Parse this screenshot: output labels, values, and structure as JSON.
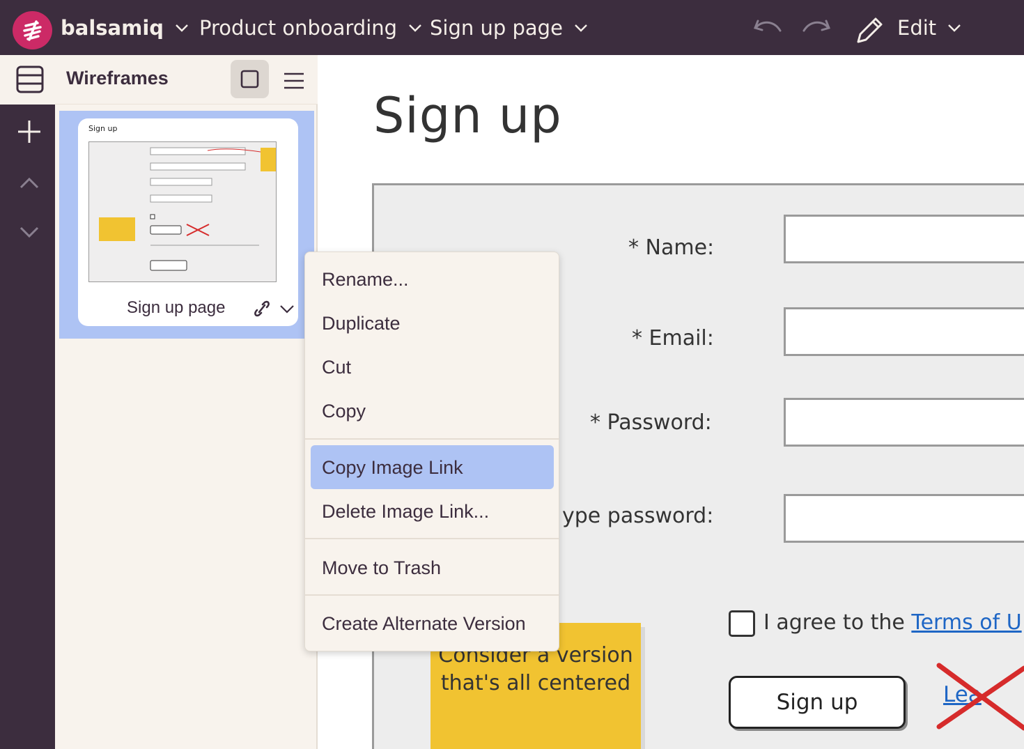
{
  "topbar": {
    "brand": "balsamiq",
    "project": "Product onboarding",
    "page": "Sign up page",
    "edit_label": "Edit"
  },
  "sidebar": {
    "title": "Wireframes",
    "thumbnail": {
      "mini_title": "Sign up",
      "name": "Sign up page"
    }
  },
  "canvas": {
    "page_title": "Sign up",
    "fields": {
      "name_label": "* Name:",
      "email_label": "* Email:",
      "password_label": "* Password:",
      "retype_label": "ype password:"
    },
    "agree_prefix": "I agree to the ",
    "agree_link": "Terms of U",
    "signup_button": "Sign up",
    "learn_link": "Lea",
    "sticky_note": "Consider a version that's all centered"
  },
  "context_menu": {
    "items": [
      "Rename...",
      "Duplicate",
      "Cut",
      "Copy",
      "Copy Image Link",
      "Delete Image Link...",
      "Move to Trash",
      "Create Alternate Version"
    ],
    "highlighted": "Copy Image Link"
  },
  "colors": {
    "topbar": "#3c2d3e",
    "brand_accent": "#cc2a66",
    "selection": "#aec3f4",
    "sticky": "#f1c331",
    "link": "#1e66c5",
    "cross": "#d62b2b"
  },
  "icons": [
    "balsamiq-logo-icon",
    "chevron-down-icon",
    "undo-icon",
    "redo-icon",
    "pencil-icon",
    "layers-icon",
    "plus-icon",
    "chevron-up-icon",
    "grid-view-icon",
    "hamburger-menu-icon",
    "link-icon"
  ]
}
